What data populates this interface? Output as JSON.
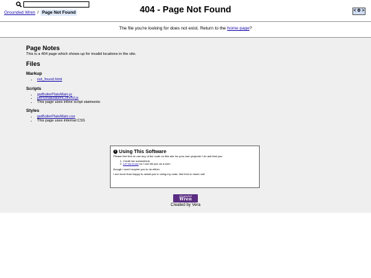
{
  "header": {
    "search": {
      "value": "",
      "placeholder": ""
    },
    "breadcrumb": {
      "home": "Grounded Wren",
      "separator": "/",
      "current": "Page Not Found"
    },
    "title": "404 - Page Not Found",
    "settings_toggle": "< ⚙ >"
  },
  "notice": {
    "text_before": "The file you're looking for does not exist. Return to the",
    "link": "home page",
    "text_after": "?"
  },
  "page_notes": {
    "heading": "Page Notes",
    "text": "This is a 404 page which shows up for invalid locations in the site."
  },
  "files": {
    "heading": "Files",
    "markup": {
      "heading": "Markup",
      "items": [
        "not_found.html"
      ]
    },
    "scripts": {
      "heading": "Scripts",
      "links": [
        "gwBoilerPlateMain.js",
        "personalizationControl.js"
      ],
      "note": "This page uses inline script statments"
    },
    "styles": {
      "heading": "Styles",
      "links": [
        "gwBoilerPlateMain.css"
      ],
      "note": "This page uses internal CSS"
    }
  },
  "software": {
    "title": "Using This Software",
    "intro": "Please feel free to use any of the code on this site for your own projects! I do ask that you:",
    "item1": "Credit me somewhere",
    "item2_link": "Let me know",
    "item2_rest": " so I can list you as a user",
    "line2": "though I won't require you to do either.",
    "line3": "I am more than happy to assist you in using my code; feel free to reach out!"
  },
  "footer": {
    "logo_top": "Grounded",
    "logo_main": "Wren",
    "credit": "Created by Vera"
  },
  "colors": {
    "link": "#1a0dab",
    "main_background": "#efefef",
    "logo_background": "#5a2d82",
    "crumb_highlight": "#dce8fb"
  }
}
